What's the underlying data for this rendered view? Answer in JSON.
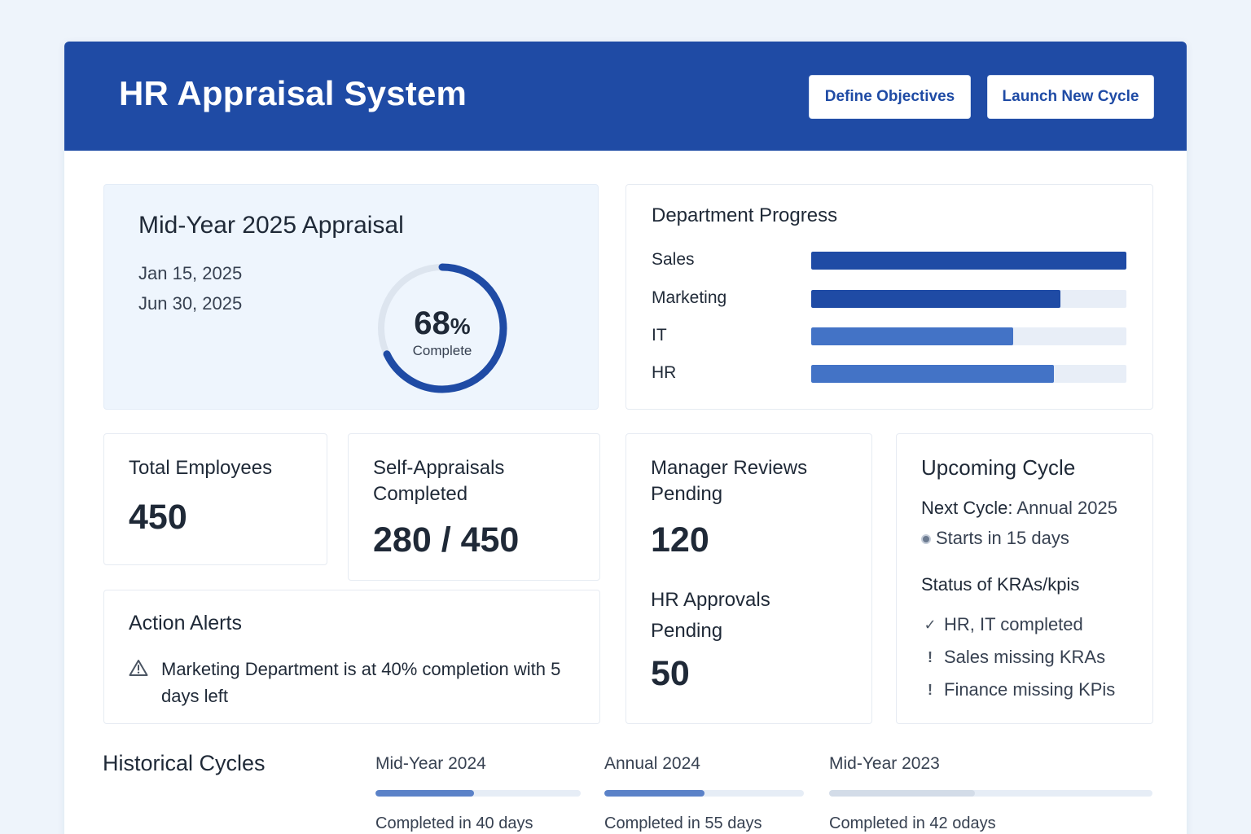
{
  "app": {
    "title": "HR Appraisal System",
    "define_label": "Define Objectives",
    "launch_label": "Launch New Cycle"
  },
  "current_cycle": {
    "title": "Mid-Year 2025 Appraisal",
    "start_date": "Jan 15, 2025",
    "end_date": "Jun 30, 2025",
    "percent_value": "68",
    "percent_symbol": "%",
    "percent_label": "Complete",
    "progress": 0.68
  },
  "department_progress": {
    "title": "Department Progress",
    "items": [
      {
        "label": "Sales",
        "progress": 1.0,
        "color": "#1f4ba5"
      },
      {
        "label": "Marketing",
        "progress": 0.79,
        "color": "#1f4ba5"
      },
      {
        "label": "IT",
        "progress": 0.64,
        "color": "#4373c6"
      },
      {
        "label": "HR",
        "progress": 0.77,
        "color": "#4373c6"
      }
    ]
  },
  "stats": {
    "total_employees": {
      "label": "Total Employees",
      "value": "450"
    },
    "self_appraisals": {
      "label": "Self-Appraisals Completed",
      "value": "280 / 450"
    },
    "manager_reviews": {
      "label": "Manager Reviews Pending",
      "value": "120"
    },
    "hr_approvals": {
      "label": "HR Approvals Pending",
      "value": "50"
    }
  },
  "upcoming": {
    "title": "Upcoming Cycle",
    "next_key": "Next Cycle:",
    "next_value": "Annual 2025",
    "starts": "Starts in 15 days",
    "status_title": "Status of KRAs/kpis",
    "status_items": [
      {
        "icon": "check-icon",
        "text": "HR, IT completed"
      },
      {
        "icon": "exclamation-icon",
        "text": "Sales missing KRAs"
      },
      {
        "icon": "exclamation-icon",
        "text": "Finance missing KPis"
      }
    ]
  },
  "alerts": {
    "title": "Action Alerts",
    "message": "Marketing Department is at 40% completion with 5 days left",
    "icon": "warning-triangle-icon"
  },
  "historical": {
    "title": "Historical Cycles",
    "cycles": [
      {
        "name": "Mid-Year 2024",
        "note": "Completed in 40 days",
        "progress": 0.48,
        "color": "#5b82c8"
      },
      {
        "name": "Annual 2024",
        "note": "Completed in 55 days",
        "progress": 0.5,
        "color": "#5b82c8"
      },
      {
        "name": "Mid-Year 2023",
        "note": "Completed in 42 odays",
        "progress": 0.45,
        "color": "#d3dce8"
      }
    ]
  },
  "colors": {
    "brand": "#1f4ba5",
    "donut_track": "#dde5ef"
  }
}
